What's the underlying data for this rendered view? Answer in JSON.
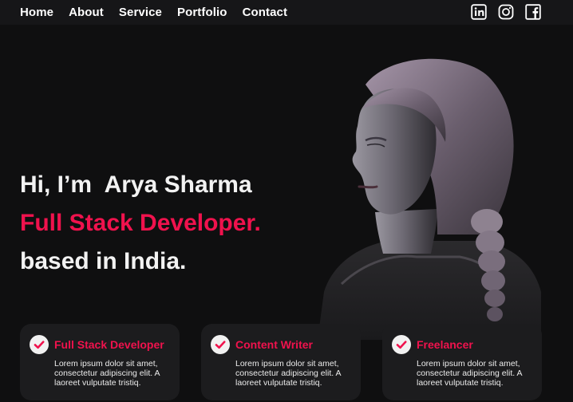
{
  "nav": {
    "links": [
      "Home",
      "About",
      "Service",
      "Portfolio",
      "Contact"
    ],
    "social_icons": [
      "linkedin-icon",
      "instagram-icon",
      "facebook-icon"
    ]
  },
  "hero": {
    "greeting": "Hi, I’m  Arya Sharma",
    "role": "Full Stack Developer.",
    "location": "based in India."
  },
  "cards": [
    {
      "title": "Full Stack Developer",
      "text": "Lorem ipsum dolor sit amet, consectetur adipiscing elit. A laoreet vulputate tristiq."
    },
    {
      "title": "Content Writer",
      "text": "Lorem ipsum dolor sit amet, consectetur adipiscing elit. A laoreet vulputate tristiq."
    },
    {
      "title": "Freelancer",
      "text": "Lorem ipsum dolor sit amet, consectetur adipiscing elit. A laoreet vulputate tristiq."
    }
  ],
  "colors": {
    "accent": "#f0124d",
    "background": "#0f0f10",
    "nav_background": "#161618",
    "card_background": "#1c1c1e"
  }
}
